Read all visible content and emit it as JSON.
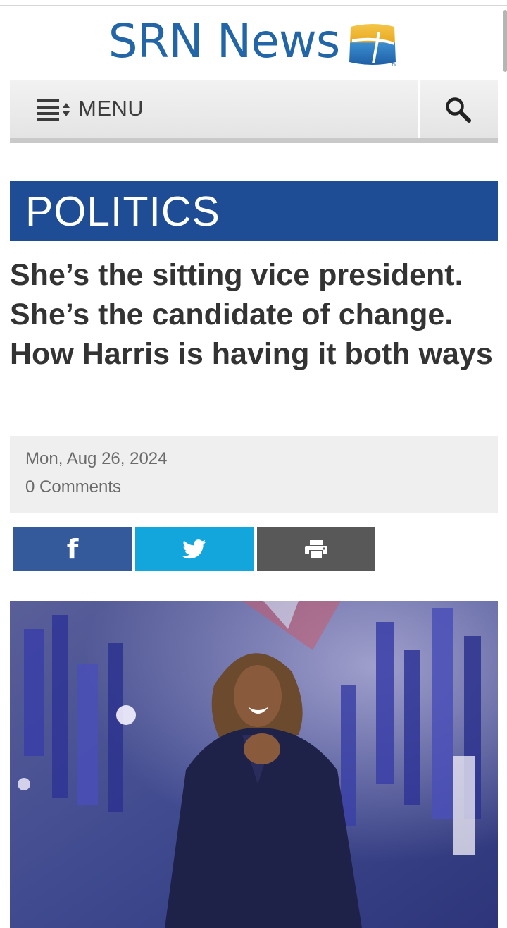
{
  "header": {
    "logo_text": "SRN News"
  },
  "nav": {
    "menu_label": "MENU",
    "menu_icon": "menu-list-icon",
    "search_icon": "search-icon"
  },
  "section": {
    "label": "POLITICS"
  },
  "article": {
    "headline": "She’s the sitting vice president. She’s the candidate of change. How Harris is having it both ways",
    "date": "Mon, Aug 26, 2024",
    "comments": "0 Comments"
  },
  "share": {
    "facebook_icon": "facebook-icon",
    "twitter_icon": "twitter-icon",
    "print_icon": "print-icon"
  },
  "colors": {
    "brand_blue": "#2366a8",
    "section_blue": "#1e4d95",
    "facebook": "#345a9c",
    "twitter": "#12a6dc",
    "print": "#585858"
  }
}
